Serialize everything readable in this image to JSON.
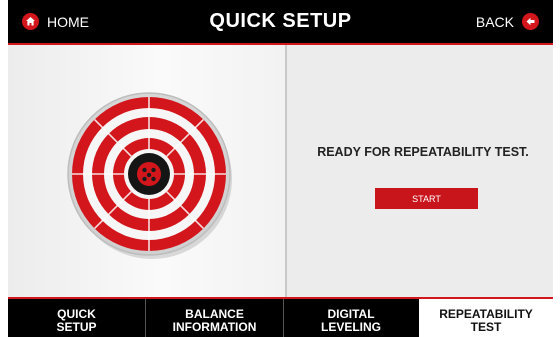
{
  "header": {
    "home_label": "HOME",
    "title": "QUICK SETUP",
    "back_label": "BACK"
  },
  "main": {
    "status_text": "READY FOR REPEATABILITY TEST.",
    "start_label": "START"
  },
  "tabs": [
    {
      "label": "QUICK\nSETUP",
      "active": false
    },
    {
      "label": "BALANCE\nINFORMATION",
      "active": false
    },
    {
      "label": "DIGITAL\nLEVELING",
      "active": false
    },
    {
      "label": "REPEATABILITY\nTEST",
      "active": true
    }
  ],
  "icons": {
    "home": "home-icon",
    "back": "back-arrow-icon",
    "target": "target-icon"
  },
  "colors": {
    "accent": "#d2161c",
    "bar_bg": "#000000",
    "panel_bg": "#ececec"
  }
}
